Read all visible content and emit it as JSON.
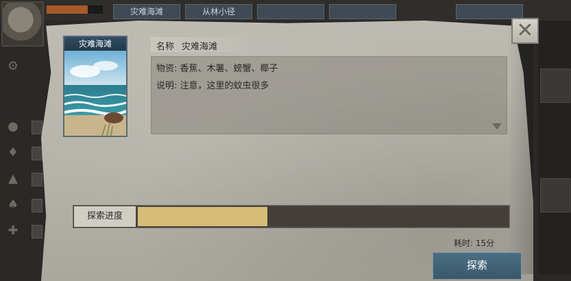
{
  "background": {
    "tabs": [
      {
        "label": "灾难海滩"
      },
      {
        "label": "从林小径"
      },
      {
        "label": "",
        "blank": true
      },
      {
        "label": "",
        "blank": true
      },
      {
        "label": "",
        "blank": true
      }
    ],
    "side_icons": [
      "bread-icon",
      "water-drop-icon",
      "campfire-icon",
      "fire-icon",
      "medical-cross-icon"
    ]
  },
  "dialog": {
    "close_glyph": "✕",
    "card": {
      "title": "灾难海滩",
      "image": "beach-scene"
    },
    "name_label": "名称",
    "name_value": "灾难海滩",
    "description": [
      "物资: 香蕉、木薯、螃蟹、椰子",
      "说明: 注意，这里的蚊虫很多"
    ],
    "progress": {
      "label": "探索进度",
      "value_fraction": 0.35
    },
    "time_cost": "耗时: 15分",
    "explore_button": "探索"
  },
  "colors": {
    "progress_fill": "#d6bd77",
    "button": "#4c6e82",
    "parchment": "#b4b1a8"
  }
}
